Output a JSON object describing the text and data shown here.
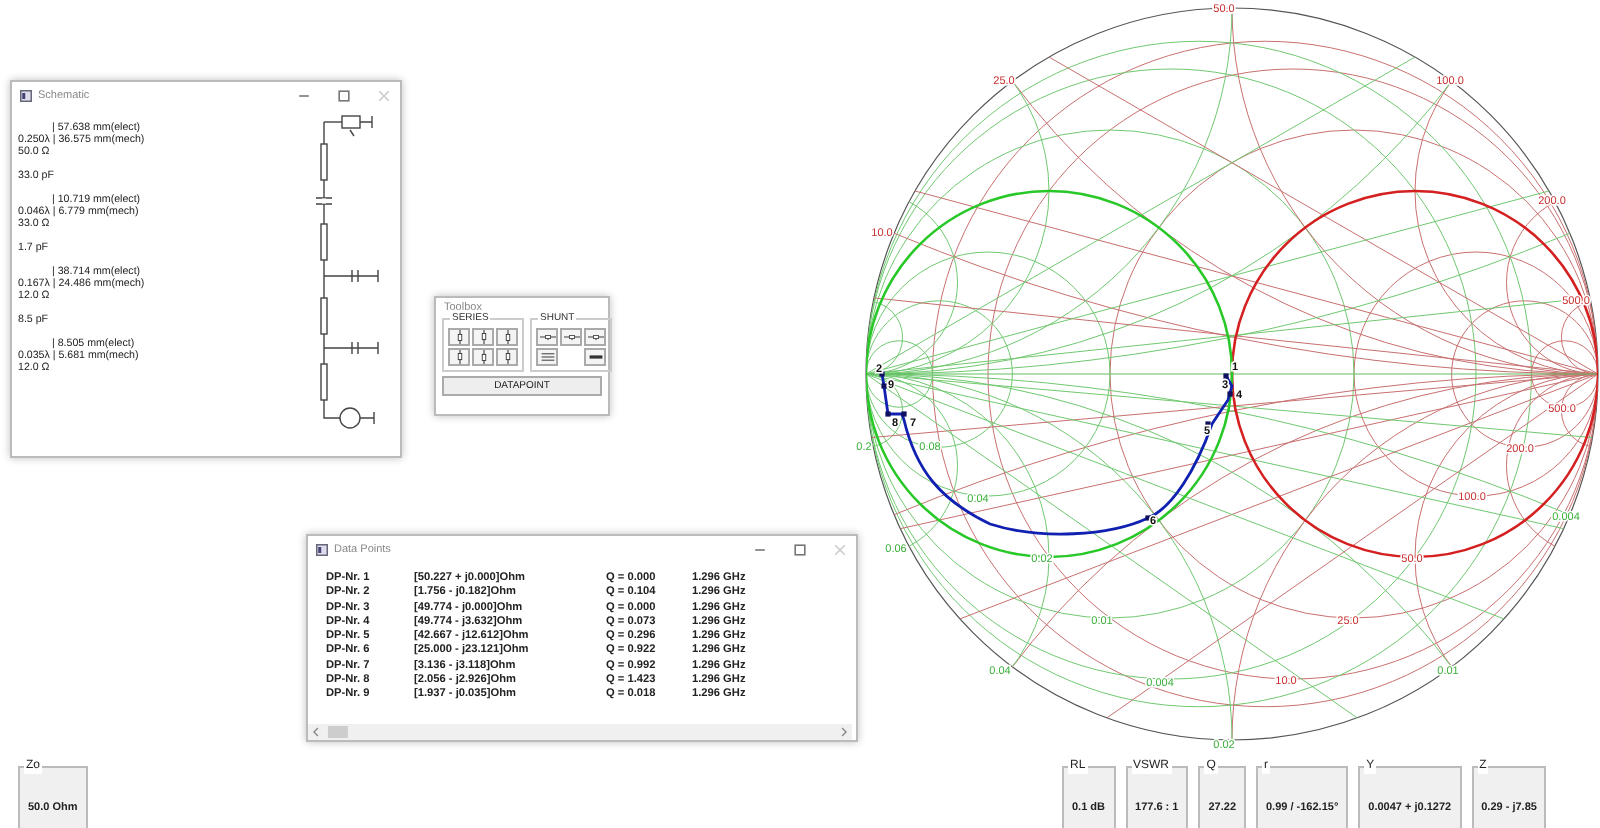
{
  "smith_chart": {
    "labels": [
      {
        "text": "50.0",
        "kind": "impedance"
      },
      {
        "text": "25.0",
        "kind": "impedance"
      },
      {
        "text": "100.0",
        "kind": "impedance"
      },
      {
        "text": "10.0",
        "kind": "impedance"
      },
      {
        "text": "200.0",
        "kind": "impedance"
      },
      {
        "text": "500.0",
        "kind": "impedance"
      },
      {
        "text": "500.0",
        "kind": "impedance"
      },
      {
        "text": "200.0",
        "kind": "impedance"
      },
      {
        "text": "100.0",
        "kind": "impedance"
      },
      {
        "text": "50.0",
        "kind": "impedance"
      },
      {
        "text": "25.0",
        "kind": "impedance"
      },
      {
        "text": "10.0",
        "kind": "impedance"
      },
      {
        "text": "0.2",
        "kind": "admittance"
      },
      {
        "text": "0.08",
        "kind": "admittance"
      },
      {
        "text": "0.04",
        "kind": "admittance"
      },
      {
        "text": "0.06",
        "kind": "admittance"
      },
      {
        "text": "0.02",
        "kind": "admittance"
      },
      {
        "text": "0.01",
        "kind": "admittance"
      },
      {
        "text": "0.04",
        "kind": "admittance"
      },
      {
        "text": "0.004",
        "kind": "admittance"
      },
      {
        "text": "0.02",
        "kind": "admittance"
      },
      {
        "text": "0.01",
        "kind": "admittance"
      },
      {
        "text": "0.004",
        "kind": "admittance"
      }
    ],
    "point_labels": [
      "1",
      "2",
      "3",
      "4",
      "5",
      "6",
      "7",
      "8",
      "9"
    ]
  },
  "schematic": {
    "title": "Schematic",
    "items": [
      {
        "kind": "line",
        "electrical": "| 57.638 mm(elect)",
        "mechanical": "0.250λ | 36.575 mm(mech)",
        "impedance": "50.0 Ω"
      },
      {
        "kind": "capacitor",
        "value": "33.0 pF"
      },
      {
        "kind": "line",
        "electrical": "| 10.719 mm(elect)",
        "mechanical": "0.046λ | 6.779 mm(mech)",
        "impedance": "33.0 Ω"
      },
      {
        "kind": "capacitor",
        "value": "1.7 pF"
      },
      {
        "kind": "line",
        "electrical": "| 38.714 mm(elect)",
        "mechanical": "0.167λ | 24.486 mm(mech)",
        "impedance": "12.0 Ω"
      },
      {
        "kind": "capacitor",
        "value": "8.5 pF"
      },
      {
        "kind": "line",
        "electrical": "| 8.505 mm(elect)",
        "mechanical": "0.035λ | 5.681 mm(mech)",
        "impedance": "12.0 Ω"
      }
    ]
  },
  "toolbox": {
    "title": "Toolbox",
    "series_label": "SERIES",
    "shunt_label": "SHUNT",
    "button": "DATAPOINT"
  },
  "data_points": {
    "title": "Data Points",
    "rows": [
      {
        "name": "DP-Nr. 1",
        "impedance": "[50.227 + j0.000]Ohm",
        "q": "Q = 0.000",
        "frequency": "1.296 GHz"
      },
      {
        "name": "DP-Nr. 2",
        "impedance": "[1.756 - j0.182]Ohm",
        "q": "Q = 0.104",
        "frequency": "1.296 GHz"
      },
      {
        "name": "DP-Nr. 3",
        "impedance": "[49.774 - j0.000]Ohm",
        "q": "Q = 0.000",
        "frequency": "1.296 GHz"
      },
      {
        "name": "DP-Nr. 4",
        "impedance": "[49.774 - j3.632]Ohm",
        "q": "Q = 0.073",
        "frequency": "1.296 GHz"
      },
      {
        "name": "DP-Nr. 5",
        "impedance": "[42.667 - j12.612]Ohm",
        "q": "Q = 0.296",
        "frequency": "1.296 GHz"
      },
      {
        "name": "DP-Nr. 6",
        "impedance": "[25.000 - j23.121]Ohm",
        "q": "Q = 0.922",
        "frequency": "1.296 GHz"
      },
      {
        "name": "DP-Nr. 7",
        "impedance": "[3.136 - j3.118]Ohm",
        "q": "Q = 0.992",
        "frequency": "1.296 GHz"
      },
      {
        "name": "DP-Nr. 8",
        "impedance": "[2.056 - j2.926]Ohm",
        "q": "Q = 1.423",
        "frequency": "1.296 GHz"
      },
      {
        "name": "DP-Nr. 9",
        "impedance": "[1.937 - j0.035]Ohm",
        "q": "Q = 0.018",
        "frequency": "1.296 GHz"
      }
    ]
  },
  "readouts_left": [
    {
      "label": "Zo",
      "value": "50.0 Ohm"
    }
  ],
  "readouts": [
    {
      "label": "RL",
      "value": "0.1 dB"
    },
    {
      "label": "VSWR",
      "value": "177.6 : 1"
    },
    {
      "label": "Q",
      "value": "27.22"
    },
    {
      "label": "r",
      "value": "0.99 / -162.15°"
    },
    {
      "label": "Y",
      "value": "0.0047 + j0.1272"
    },
    {
      "label": "Z",
      "value": "0.29 - j7.85"
    }
  ]
}
